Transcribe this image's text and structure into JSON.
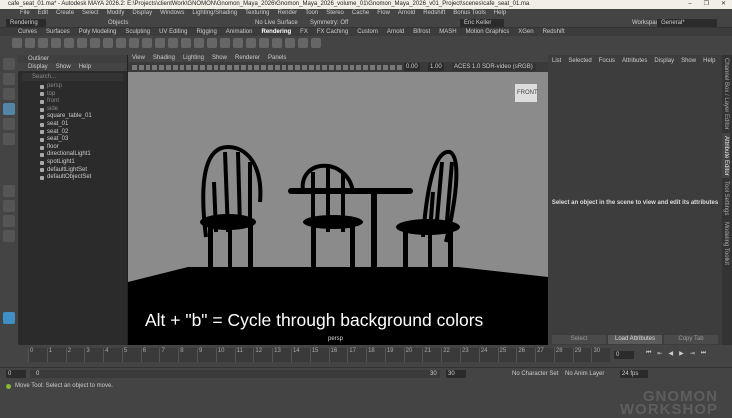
{
  "window": {
    "title": "cafe_seat_01.ma* - Autodesk MAYA 2026.2: E:\\Projects\\clientWork\\GNOMON\\Gnomon_Maya_2026\\Gnomon_Maya_2026_volume_01\\Gnomon_Maya_2026_v01_Project\\scenes\\cafe_seat_01.ma",
    "minimize": "–",
    "maximize": "❐",
    "close": "✕"
  },
  "menubar": [
    "File",
    "Edit",
    "Create",
    "Select",
    "Modify",
    "Display",
    "Windows",
    "Lighting/Shading",
    "Texturing",
    "Render",
    "Toon",
    "Stereo",
    "Cache",
    "Flow",
    "Arnold",
    "Redshift",
    "Bonus Tools",
    "Help"
  ],
  "status": {
    "menuset": "Rendering",
    "objects": "Objects",
    "live_surface": "No Live Surface",
    "symmetry": "Symmetry: Off",
    "user": "Eric Keller",
    "workspace_label": "Workspace:",
    "workspace": "General*"
  },
  "shelf_tabs": [
    "Curves",
    "Surfaces",
    "Poly Modeling",
    "Sculpting",
    "UV Editing",
    "Rigging",
    "Animation",
    "Rendering",
    "FX",
    "FX Caching",
    "Custom",
    "Arnold",
    "Bifrost",
    "MASH",
    "Motion Graphics",
    "XGen",
    "Redshift"
  ],
  "shelf_active": "Rendering",
  "outliner": {
    "title": "Outliner",
    "menu": [
      "Display",
      "Show",
      "Help"
    ],
    "search_placeholder": "Search...",
    "items": [
      {
        "name": "persp",
        "dim": true
      },
      {
        "name": "top",
        "dim": true
      },
      {
        "name": "front",
        "dim": true
      },
      {
        "name": "side",
        "dim": true
      },
      {
        "name": "square_table_01"
      },
      {
        "name": "seat_01"
      },
      {
        "name": "seat_02"
      },
      {
        "name": "seat_03"
      },
      {
        "name": "floor"
      },
      {
        "name": "directionalLight1"
      },
      {
        "name": "spotLight1"
      },
      {
        "name": "defaultLightSet"
      },
      {
        "name": "defaultObjectSet"
      }
    ]
  },
  "viewport": {
    "menu": [
      "View",
      "Shading",
      "Lighting",
      "Show",
      "Renderer",
      "Panels"
    ],
    "exposure": "0.00",
    "gamma": "1.00",
    "color_space": "ACES 1.0 SDR-video (sRGB)",
    "camera_label": "persp",
    "viewcube": "FRONT",
    "caption": "Alt + \"b\" = Cycle through background colors",
    "bg_color": "#8b8b8b"
  },
  "attribute_editor": {
    "menu": [
      "List",
      "Selected",
      "Focus",
      "Attributes",
      "Display",
      "Show",
      "Help"
    ],
    "message": "Select an object in the scene to view and edit its attributes",
    "buttons": [
      "Select",
      "Load Attributes",
      "Copy Tab"
    ]
  },
  "side_tabs": [
    "Channel Box / Layer Editor",
    "Attribute Editor",
    "Tool Settings",
    "Modeling Toolkit"
  ],
  "timeline": {
    "ticks": [
      "0",
      "1",
      "2",
      "3",
      "4",
      "5",
      "6",
      "7",
      "8",
      "9",
      "10",
      "11",
      "12",
      "13",
      "14",
      "15",
      "16",
      "17",
      "18",
      "19",
      "20",
      "21",
      "22",
      "23",
      "24",
      "25",
      "26",
      "27",
      "28",
      "29",
      "30"
    ],
    "current_frame": "0"
  },
  "range": {
    "start": "0",
    "inner_start": "0",
    "inner_end": "30",
    "end": "30",
    "character_set": "No Character Set",
    "anim_layer": "No Anim Layer",
    "fps": "24 fps"
  },
  "help_line": "Move Tool: Select an object to move.",
  "watermark": "THE GNOMON WORKSHOP"
}
